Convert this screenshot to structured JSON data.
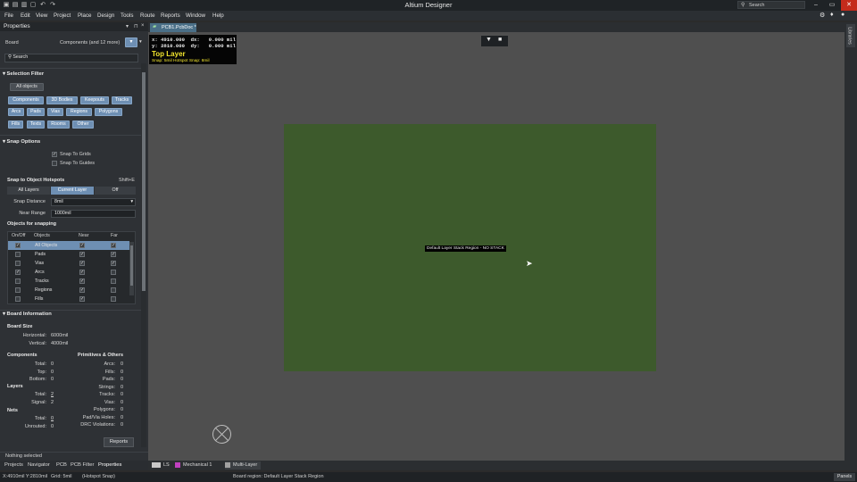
{
  "app": {
    "title": "Altium Designer"
  },
  "search": {
    "label": "Search"
  },
  "menu": [
    "File",
    "Edit",
    "View",
    "Project",
    "Place",
    "Design",
    "Tools",
    "Route",
    "Reports",
    "Window",
    "Help"
  ],
  "properties": {
    "title": "Properties",
    "board_label": "Board",
    "components_filter": "Components (and 12 more)",
    "search_placeholder": "Search",
    "selection_filter": {
      "heading": "Selection Filter",
      "all_objects": "All objects",
      "chips": [
        "Components",
        "3D Bodies",
        "Keepouts",
        "Tracks",
        "Arcs",
        "Pads",
        "Vias",
        "Regions",
        "Polygons",
        "Fills",
        "Texts",
        "Rooms",
        "Other"
      ]
    },
    "snap_options": {
      "heading": "Snap Options",
      "snap_to_grids": "Snap To Grids",
      "snap_to_guides": "Snap To Guides",
      "hotspots_heading": "Snap to Object Hotspots",
      "shortcut": "Shift+E",
      "modes": [
        "All Layers",
        "Current Layer",
        "Off"
      ],
      "snap_distance_label": "Snap Distance",
      "snap_distance_value": "8mil",
      "near_range_label": "Near Range",
      "near_range_value": "1000mil",
      "objects_heading": "Objects for snapping",
      "table_headers": [
        "On/Off",
        "Objects",
        "Near",
        "Far"
      ],
      "table_rows": [
        {
          "name": "All Objects",
          "on": true,
          "near": true,
          "far": true
        },
        {
          "name": "Pads",
          "on": false,
          "near": true,
          "far": true
        },
        {
          "name": "Vias",
          "on": false,
          "near": true,
          "far": true
        },
        {
          "name": "Arcs",
          "on": true,
          "near": true,
          "far": false
        },
        {
          "name": "Tracks",
          "on": false,
          "near": true,
          "far": false
        },
        {
          "name": "Regions",
          "on": false,
          "near": true,
          "far": false
        },
        {
          "name": "Fills",
          "on": false,
          "near": true,
          "far": false
        }
      ]
    },
    "board_info": {
      "heading": "Board Information",
      "board_size": "Board Size",
      "horizontal_label": "Horizontal:",
      "horizontal_value": "6000mil",
      "vertical_label": "Vertical:",
      "vertical_value": "4000mil",
      "components": "Components",
      "total_label": "Total:",
      "total_value": "0",
      "top_label": "Top:",
      "top_value": "0",
      "bottom_label": "Bottom:",
      "bottom_value": "0",
      "layers": "Layers",
      "layers_total_label": "Total:",
      "layers_total_value": "2",
      "signal_label": "Signal:",
      "signal_value": "2",
      "nets": "Nets",
      "nets_total_label": "Total:",
      "nets_total_value": "0",
      "unrouted_label": "Unrouted:",
      "unrouted_value": "0",
      "primitives": "Primitives & Others",
      "prims": [
        {
          "label": "Arcs:",
          "value": "0"
        },
        {
          "label": "Fills:",
          "value": "0"
        },
        {
          "label": "Pads:",
          "value": "0"
        },
        {
          "label": "Strings:",
          "value": "0"
        },
        {
          "label": "Tracks:",
          "value": "0"
        },
        {
          "label": "Vias:",
          "value": "0"
        },
        {
          "label": "Polygons:",
          "value": "0"
        },
        {
          "label": "Pad/Via Holes:",
          "value": "0"
        },
        {
          "label": "DRC Violations:",
          "value": "0"
        }
      ],
      "reports_button": "Reports"
    },
    "nothing_selected": "Nothing selected"
  },
  "panel_tabs": [
    "Projects",
    "Navigator",
    "PCB",
    "PCB Filter",
    "Properties"
  ],
  "document_tab": {
    "icon": "PCB-icon",
    "label": "PCB1.PcbDoc *"
  },
  "heads_up": {
    "line1": "x: 4910.000  dx:   0.000 mil",
    "line2": "y: 2810.000  dy:   0.000 mil",
    "layer": "Top Layer",
    "snap": "Snap: 5mil Hotspot Snap: 8mil"
  },
  "board_tooltip": "Default Layer Stack Region - NO STACK",
  "libraries_tab": "Libraries",
  "layer_tabs": [
    {
      "label": "LS",
      "color": "#c8c8c8"
    },
    {
      "label": "Mechanical 1",
      "color": "#c040c0"
    },
    {
      "label": "Multi-Layer",
      "color": "#a0a0a0"
    }
  ],
  "status": {
    "coords": "X:4910mil Y:2810mil",
    "grid": "Grid: 5mil",
    "snap": "(Hotspot Snap)",
    "region": "Board region: Default Layer Stack Region",
    "panels": "Panels"
  },
  "colors": {
    "board": "#3d5a2c",
    "accent": "#6e8fb3",
    "layer_text": "#f2e52e"
  }
}
